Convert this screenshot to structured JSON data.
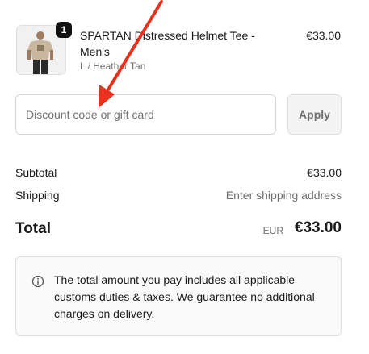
{
  "product": {
    "quantity": "1",
    "name": "SPARTAN Distressed Helmet Tee - Men's",
    "variant": "L / Heather Tan",
    "price": "€33.00"
  },
  "discount": {
    "placeholder": "Discount code or gift card",
    "value": "",
    "apply_label": "Apply"
  },
  "summary": {
    "subtotal_label": "Subtotal",
    "subtotal_value": "€33.00",
    "shipping_label": "Shipping",
    "shipping_value": "Enter shipping address",
    "total_label": "Total",
    "currency": "EUR",
    "total_value": "€33.00"
  },
  "notice": {
    "icon": "info-icon",
    "text": "The total amount you pay includes all applicable customs duties & taxes. We guarantee no additional charges on delivery."
  },
  "annotation": {
    "arrow_color": "#e8321e"
  }
}
